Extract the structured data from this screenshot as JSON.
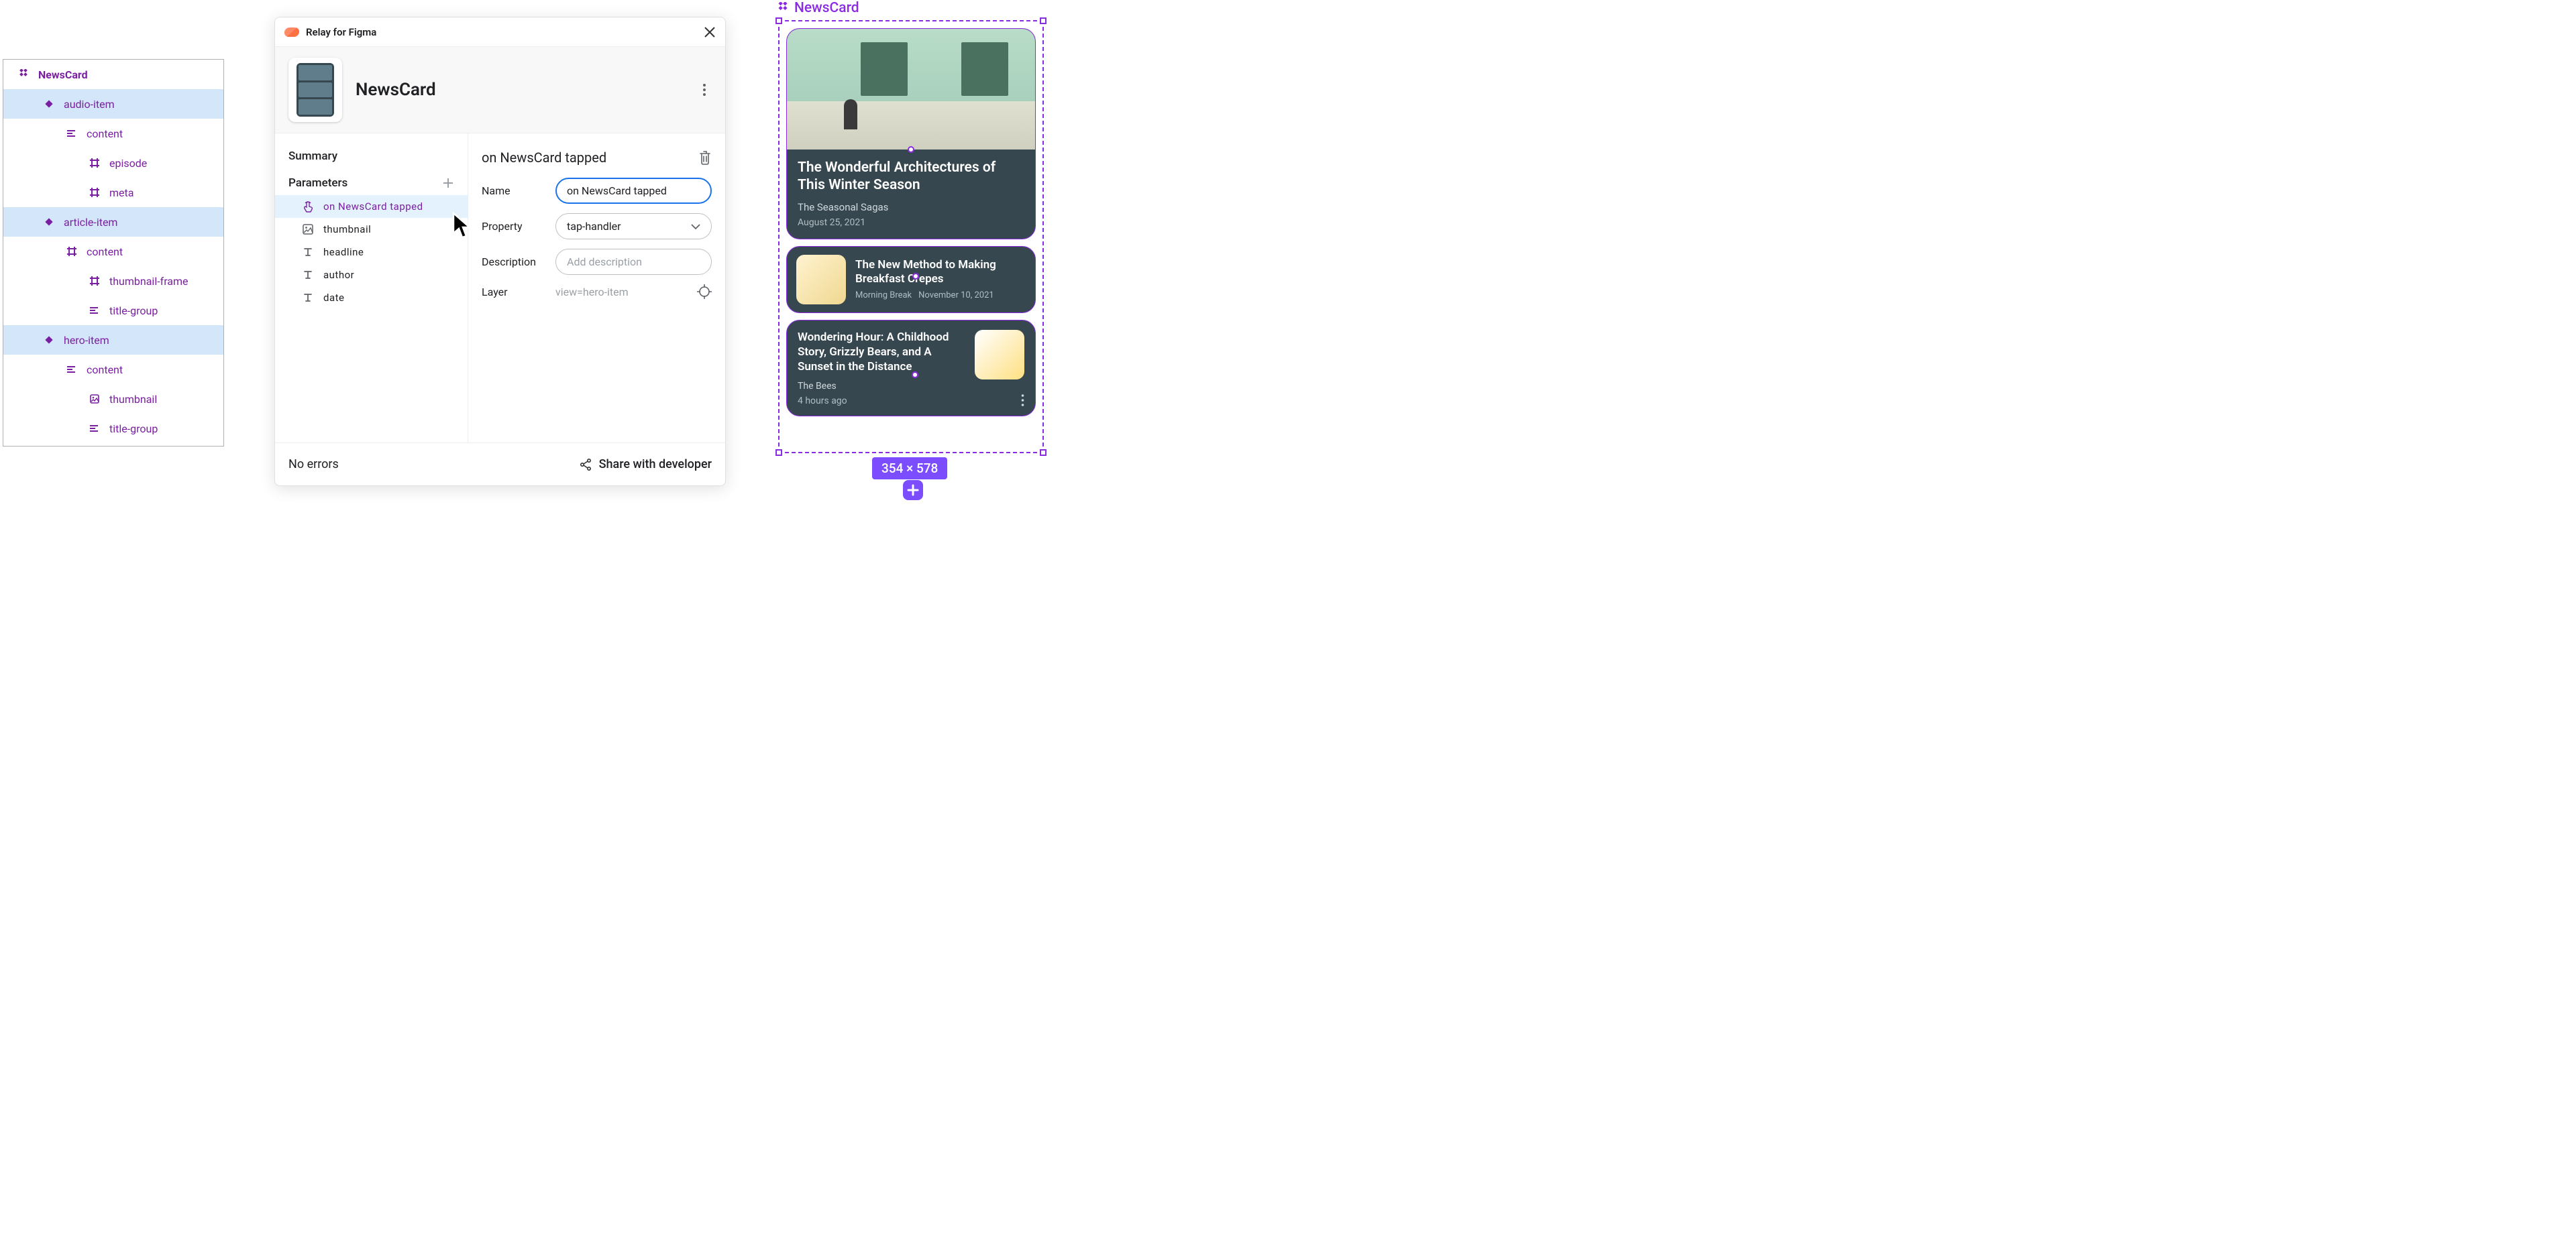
{
  "layers": {
    "root": "NewsCard",
    "items": [
      {
        "label": "audio-item",
        "type": "variant",
        "depth": 1,
        "selected": true
      },
      {
        "label": "content",
        "type": "group",
        "depth": 2,
        "selected": false
      },
      {
        "label": "episode",
        "type": "frame",
        "depth": 3,
        "selected": false
      },
      {
        "label": "meta",
        "type": "frame",
        "depth": 3,
        "selected": false
      },
      {
        "label": "article-item",
        "type": "variant",
        "depth": 1,
        "selected": true
      },
      {
        "label": "content",
        "type": "frame",
        "depth": 2,
        "selected": false
      },
      {
        "label": "thumbnail-frame",
        "type": "frame",
        "depth": 3,
        "selected": false
      },
      {
        "label": "title-group",
        "type": "group",
        "depth": 3,
        "selected": false
      },
      {
        "label": "hero-item",
        "type": "variant",
        "depth": 1,
        "selected": true
      },
      {
        "label": "content",
        "type": "group",
        "depth": 2,
        "selected": false
      },
      {
        "label": "thumbnail",
        "type": "image",
        "depth": 3,
        "selected": false
      },
      {
        "label": "title-group",
        "type": "group",
        "depth": 3,
        "selected": false
      }
    ]
  },
  "relay": {
    "plugin_title": "Relay for Figma",
    "component_name": "NewsCard",
    "left": {
      "summary_label": "Summary",
      "parameters_label": "Parameters",
      "params": [
        {
          "icon": "tap",
          "label": "on NewsCard tapped",
          "selected": true
        },
        {
          "icon": "image",
          "label": "thumbnail",
          "selected": false
        },
        {
          "icon": "text",
          "label": "headline",
          "selected": false
        },
        {
          "icon": "text",
          "label": "author",
          "selected": false
        },
        {
          "icon": "text",
          "label": "date",
          "selected": false
        }
      ]
    },
    "right": {
      "title": "on NewsCard tapped",
      "name_label": "Name",
      "name_value": "on NewsCard tapped",
      "property_label": "Property",
      "property_value": "tap-handler",
      "description_label": "Description",
      "description_placeholder": "Add description",
      "layer_label": "Layer",
      "layer_value": "view=hero-item"
    },
    "footer": {
      "no_errors": "No errors",
      "share": "Share with developer"
    }
  },
  "canvas": {
    "label": "NewsCard",
    "size_badge": "354 × 578",
    "hero": {
      "headline": "The Wonderful Architectures of This Winter Season",
      "author": "The Seasonal Sagas",
      "date": "August 25, 2021"
    },
    "article": {
      "headline": "The New Method to Making Breakfast Crepes",
      "author": "Morning Break",
      "date": "November 10, 2021"
    },
    "audio": {
      "headline": "Wondering Hour: A Childhood Story, Grizzly Bears, and A Sunset in the Distance",
      "author": "The Bees",
      "date": "4 hours ago"
    }
  }
}
